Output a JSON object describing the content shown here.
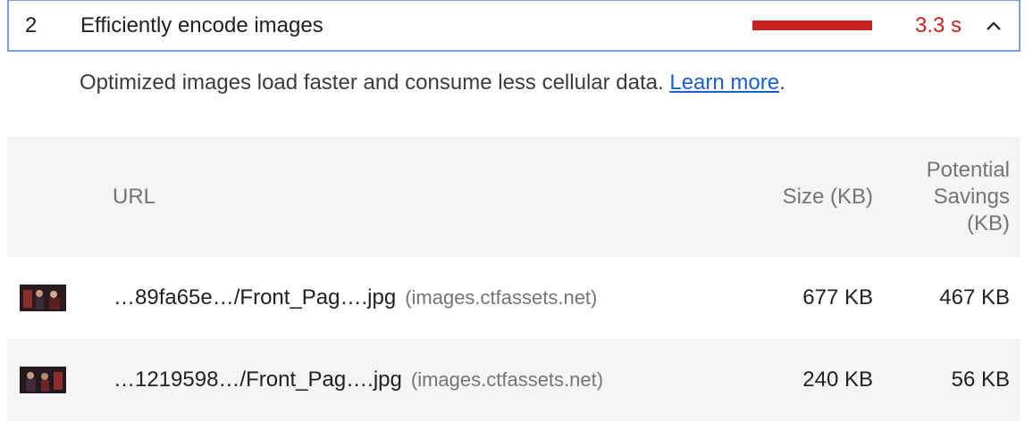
{
  "audit": {
    "index": "2",
    "title": "Efficiently encode images",
    "savings_display": "3.3 s",
    "status_color": "#c7221f",
    "description": "Optimized images load faster and consume less cellular data.",
    "learn_more": "Learn more",
    "learn_more_suffix": ".",
    "toggle_icon": "chevron-up-icon"
  },
  "table": {
    "headers": {
      "url": "URL",
      "size": "Size (KB)",
      "savings_line1": "Potential",
      "savings_line2": "Savings",
      "savings_line3": "(KB)"
    },
    "rows": [
      {
        "url": "…89fa65e…/Front_Pag….jpg",
        "host": "(images.ctfassets.net)",
        "size": "677 KB",
        "savings": "467 KB"
      },
      {
        "url": "…1219598…/Front_Pag….jpg",
        "host": "(images.ctfassets.net)",
        "size": "240 KB",
        "savings": "56 KB"
      }
    ]
  }
}
